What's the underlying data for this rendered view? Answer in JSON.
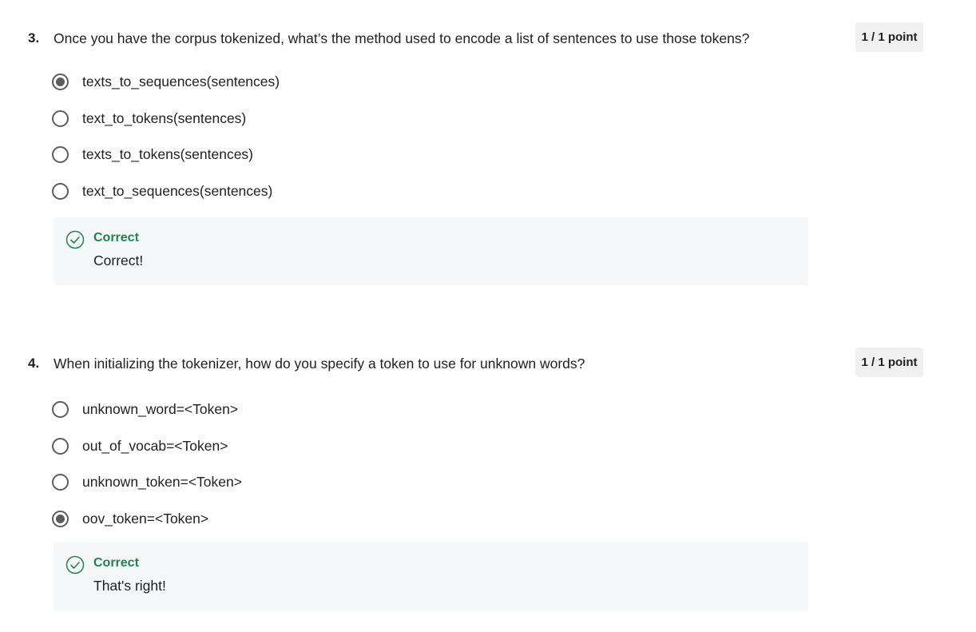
{
  "questions": [
    {
      "number": "3.",
      "text": "Once you have the corpus tokenized, what’s the method used to encode a list of sentences to use those tokens?",
      "points": "1 / 1 point",
      "options": [
        {
          "label": "texts_to_sequences(sentences)",
          "selected": true
        },
        {
          "label": "text_to_tokens(sentences)",
          "selected": false
        },
        {
          "label": "texts_to_tokens(sentences)",
          "selected": false
        },
        {
          "label": "text_to_sequences(sentences)",
          "selected": false
        }
      ],
      "feedback": {
        "title": "Correct",
        "text": "Correct!",
        "icon": "check-circle-icon"
      }
    },
    {
      "number": "4.",
      "text": "When initializing the tokenizer, how do you specify a token to use for unknown words?",
      "points": "1 / 1 point",
      "options": [
        {
          "label": "unknown_word=<Token>",
          "selected": false
        },
        {
          "label": "out_of_vocab=<Token>",
          "selected": false
        },
        {
          "label": "unknown_token=<Token>",
          "selected": false
        },
        {
          "label": "oov_token=<Token>",
          "selected": true
        }
      ],
      "feedback": {
        "title": "Correct",
        "text": "That's right!",
        "icon": "check-circle-icon"
      }
    }
  ],
  "colors": {
    "correct": "#1f8354",
    "radio": "#5c5c5c",
    "feedback_bg": "#f5f7f8",
    "points_bg": "#f0f0f0"
  }
}
